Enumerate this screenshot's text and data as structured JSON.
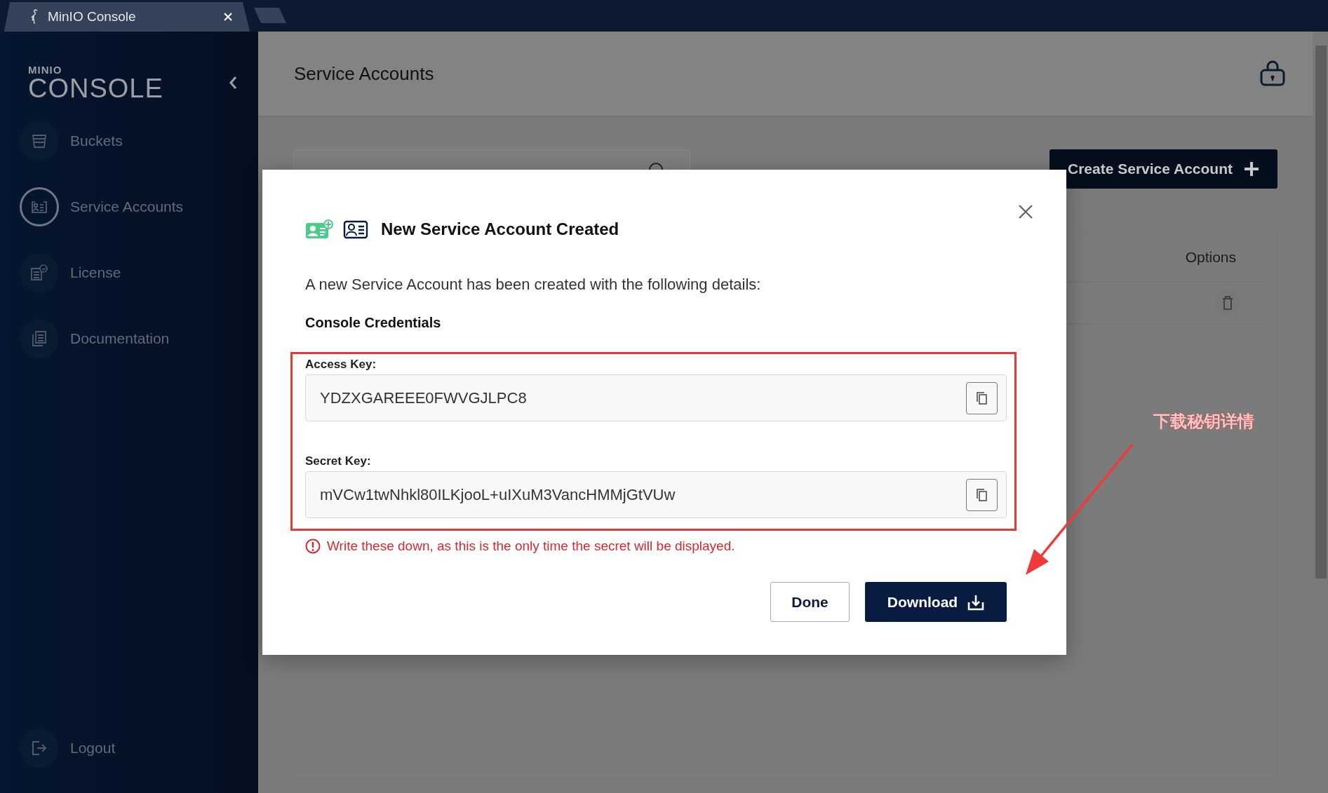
{
  "browser": {
    "tab_title": "MinIO Console"
  },
  "sidebar": {
    "logo_top": "MINIO",
    "logo_bottom": "CONSOLE",
    "items": [
      {
        "label": "Buckets",
        "kind": "bucket",
        "selected": false
      },
      {
        "label": "Service Accounts",
        "kind": "id-card",
        "selected": true
      },
      {
        "label": "License",
        "kind": "license",
        "selected": false
      },
      {
        "label": "Documentation",
        "kind": "docs",
        "selected": false
      }
    ],
    "logout": {
      "label": "Logout",
      "kind": "logout"
    }
  },
  "page": {
    "title": "Service Accounts",
    "search": {
      "kind": "search"
    },
    "create_button": "Create Service Account",
    "table": {
      "columns": [
        "Options"
      ]
    }
  },
  "modal": {
    "title": "New Service Account Created",
    "description": "A new Service Account has been created with the following details:",
    "section": "Console Credentials",
    "fields": [
      {
        "label": "Access Key:",
        "value": "YDZXGAREEE0FWVGJLPC8"
      },
      {
        "label": "Secret Key:",
        "value": "mVCw1twNhkl80ILKjooL+uIXuM3VancHMMjGtVUw"
      }
    ],
    "warning": "Write these down, as this is the only time the secret will be displayed.",
    "buttons": [
      {
        "label": "Done",
        "kind": "secondary"
      },
      {
        "label": "Download",
        "kind": "primary"
      }
    ]
  },
  "annotation": {
    "text": "下载秘钥详情"
  }
}
